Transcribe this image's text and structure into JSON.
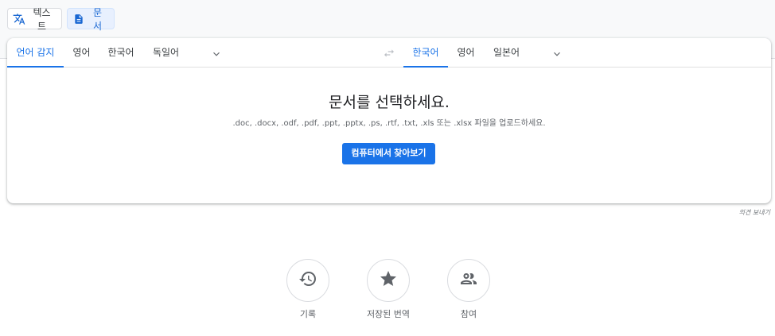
{
  "mode_tabs": {
    "text_label": "텍스트",
    "text_icon": "translate-icon",
    "document_label": "문서",
    "document_icon": "document-icon",
    "active": "document"
  },
  "source_languages": {
    "tabs": [
      "언어 감지",
      "영어",
      "한국어",
      "독일어"
    ],
    "active_index": 0,
    "more_icon": "chevron-down-icon"
  },
  "swap_icon": "swap-arrows-icon",
  "target_languages": {
    "tabs": [
      "한국어",
      "영어",
      "일본어"
    ],
    "active_index": 0,
    "more_icon": "chevron-down-icon"
  },
  "drop_zone": {
    "title": "문서를 선택하세요.",
    "subtitle": ".doc, .docx, .odf, .pdf, .ppt, .pptx, .ps, .rtf, .txt, .xls 또는 .xlsx 파일을 업로드하세요.",
    "browse_label": "컴퓨터에서 찾아보기"
  },
  "feedback_link": "의견 보내기",
  "bottom_actions": [
    {
      "label": "기록",
      "icon": "history-icon"
    },
    {
      "label": "저장된 번역",
      "icon": "star-icon"
    },
    {
      "label": "참여",
      "icon": "community-icon"
    }
  ],
  "colors": {
    "accent": "#1a73e8",
    "active_chip_bg": "#e8f0fe",
    "text_primary": "#202124",
    "text_secondary": "#5f6368"
  }
}
